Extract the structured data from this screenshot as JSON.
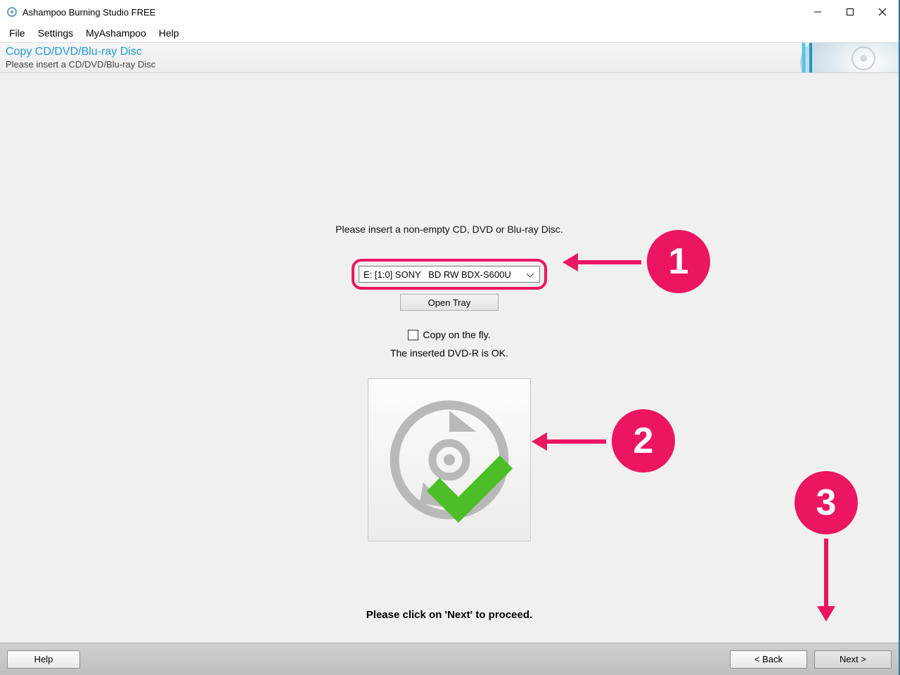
{
  "window": {
    "title": "Ashampoo Burning Studio FREE"
  },
  "menu": {
    "items": [
      "File",
      "Settings",
      "MyAshampoo",
      "Help"
    ]
  },
  "subheader": {
    "heading": "Copy CD/DVD/Blu-ray Disc",
    "subtitle": "Please insert a CD/DVD/Blu-ray Disc"
  },
  "main": {
    "instruction": "Please insert a non-empty CD, DVD or Blu-ray Disc.",
    "drive_selection": "E: [1:0] SONY   BD RW BDX-S600U",
    "open_tray": "Open Tray",
    "copy_on_fly": "Copy on the fly.",
    "copy_on_fly_checked": false,
    "status": "The inserted DVD-R is OK.",
    "proceed": "Please click on 'Next' to proceed."
  },
  "nav": {
    "help": "Help",
    "back": "< Back",
    "next": "Next >"
  },
  "annotations": {
    "b1": "1",
    "b2": "2",
    "b3": "3"
  },
  "colors": {
    "accent": "#ec1561",
    "link": "#1f9bd8"
  }
}
